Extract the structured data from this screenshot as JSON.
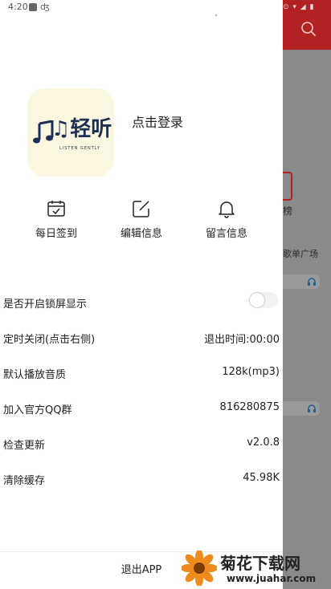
{
  "status_bar": {
    "time": "4:20",
    "bug": "ʤ",
    "bg_icons": "⊙ ▾ ◢ ▮"
  },
  "drawer": {
    "logo": {
      "text": "♫轻听",
      "subtitle": "LISTEN GENTLY"
    },
    "login_label": "点击登录",
    "quick_actions": [
      {
        "icon": "calendar-check-icon",
        "label": "每日签到"
      },
      {
        "icon": "edit-icon",
        "label": "编辑信息"
      },
      {
        "icon": "bell-icon",
        "label": "留言信息"
      }
    ],
    "settings": {
      "lock_screen": {
        "label": "是否开启锁屏显示",
        "enabled": false
      },
      "timer": {
        "label": "定时关闭(点击右侧)",
        "value": "退出时间:00:00"
      },
      "quality": {
        "label": "默认播放音质",
        "value": "128k(mp3)"
      },
      "qq_group": {
        "label": "加入官方QQ群",
        "value": "816280875"
      },
      "update": {
        "label": "检查更新",
        "value": "v2.0.8"
      },
      "cache": {
        "label": "清除缓存",
        "value": "45.98K"
      }
    },
    "exit_label": "退出APP"
  },
  "background": {
    "rank_label": "榜",
    "square_label": "歌单广场"
  },
  "watermark": {
    "title": "菊花下载网",
    "url": "www.juahar.com"
  },
  "colors": {
    "accent": "#b22222",
    "overlay": "#8a8a8a",
    "logo_bg": "#fbf7e0",
    "logo_ink": "#1d2f55"
  }
}
